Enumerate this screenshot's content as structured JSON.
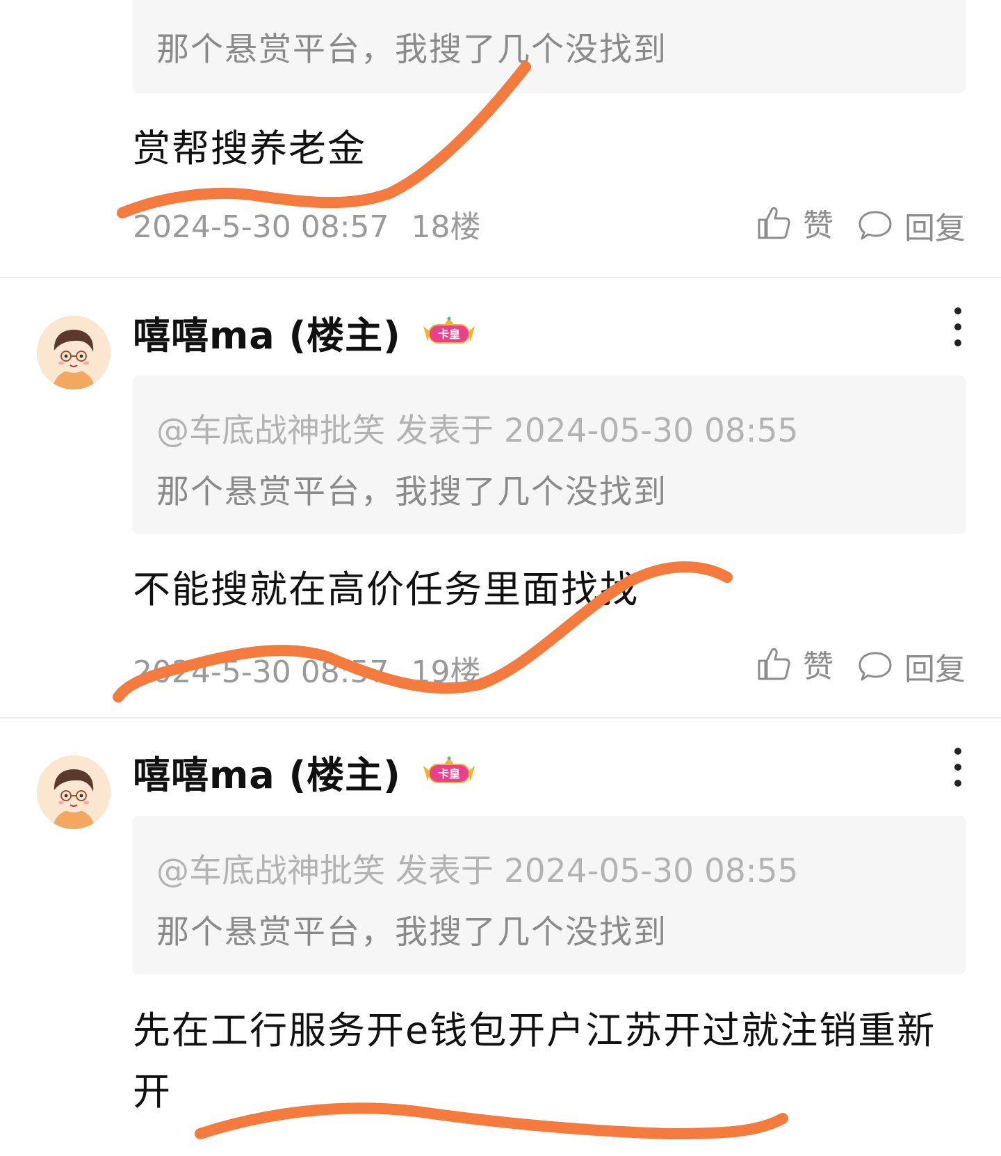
{
  "quote": {
    "meta": "@车底战神批笑 发表于 2024-05-30 08:55",
    "text": "那个悬赏平台，我搜了几个没找到"
  },
  "actions": {
    "like_label": "赞",
    "reply_label": "回复"
  },
  "posts": [
    {
      "quote_text": "那个悬赏平台，我搜了几个没找到",
      "content": "赏帮搜养老金",
      "time": "2024-5-30 08:57",
      "floor": "18楼"
    },
    {
      "username": "嘻嘻ma (楼主)",
      "badge_text": "卡皇",
      "quote_meta": "@车底战神批笑 发表于 2024-05-30 08:55",
      "quote_text": "那个悬赏平台，我搜了几个没找到",
      "content": "不能搜就在高价任务里面找找",
      "time": "2024-5-30 08:57",
      "floor": "19楼"
    },
    {
      "username": "嘻嘻ma (楼主)",
      "badge_text": "卡皇",
      "quote_meta": "@车底战神批笑 发表于 2024-05-30 08:55",
      "quote_text": "那个悬赏平台，我搜了几个没找到",
      "content": "先在工行服务开e钱包开户江苏开过就注销重新开"
    }
  ],
  "colors": {
    "scribble": "#f47a3e",
    "quote_bg": "#f6f6f6",
    "muted_text": "#9a9a9a",
    "badge_pink": "#e8408c",
    "badge_gold": "#f2b531"
  },
  "icons": {
    "like": "thumbs-up-icon",
    "reply": "speech-bubble-icon",
    "more": "vertical-ellipsis-icon"
  }
}
